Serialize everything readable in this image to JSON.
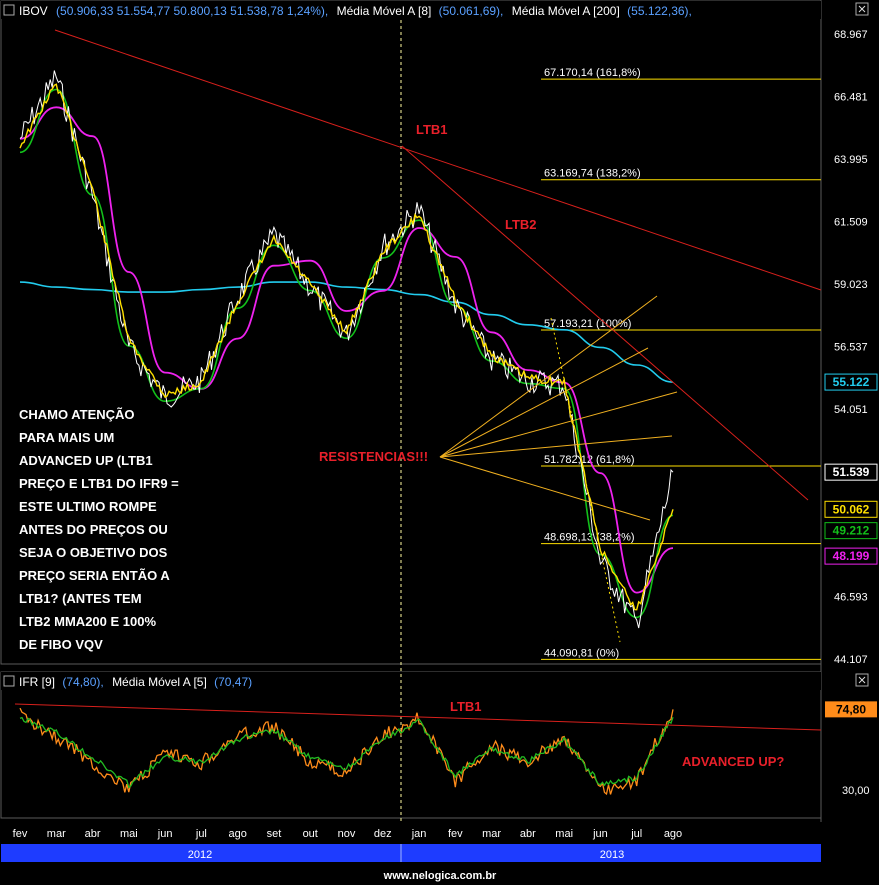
{
  "header_price": {
    "symbol": "IBOV",
    "ohlc": "(50.906,33  51.554,77  50.800,13  51.538,78  1,24%),",
    "ma1_label": "Média Móvel A [8]",
    "ma1_value": "(50.061,69),",
    "ma2_label": "Média Móvel A [200]",
    "ma2_value": "(55.122,36),"
  },
  "header_ifr": {
    "label": "IFR [9]",
    "value": "(74,80),",
    "ma_label": "Média Móvel A [5]",
    "ma_value": "(70,47)"
  },
  "colors": {
    "price": "#ffffff",
    "ma8": "#ffe100",
    "ma_green": "#12c01a",
    "ma_magenta": "#ee22ee",
    "ma200": "#22ccee",
    "trend": "#d8201c",
    "fibo": "#ffe100",
    "fan": "#f0b020",
    "ifr": "#ff8c1a",
    "ifr_ma": "#22bb22",
    "accent_blue": "#1e3cff"
  },
  "annotations": {
    "ltb1": "LTB1",
    "ltb2": "LTB2",
    "resistencias": "RESISTENCIAS!!!",
    "ltb1_ifr": "LTB1",
    "advanced_up": "ADVANCED UP?",
    "note_lines": [
      "CHAMO ATENÇÃO",
      "PARA MAIS UM",
      "ADVANCED UP (LTB1",
      "PREÇO E LTB1 DO IFR9 =",
      "ESTE ULTIMO ROMPE",
      "ANTES DO PREÇOS OU",
      "SEJA O OBJETIVO DOS",
      "PREÇO SERIA ENTÃO A",
      "LTB1? (ANTES TEM",
      "LTB2 MMA200 E 100%",
      "DE FIBO VQV"
    ]
  },
  "price_axis": {
    "ticks": [
      "68.967",
      "66.481",
      "63.995",
      "61.509",
      "59.023",
      "56.537",
      "54.051",
      "46.593",
      "44.107"
    ],
    "badges": [
      {
        "label": "55.122",
        "bg": "#000000",
        "fg": "#22ccee"
      },
      {
        "label": "51.539",
        "bg": "#000000",
        "fg": "#ffffff"
      },
      {
        "label": "50.062",
        "bg": "#000000",
        "fg": "#ffe100"
      },
      {
        "label": "49.212",
        "bg": "#000000",
        "fg": "#12c01a"
      },
      {
        "label": "48.199",
        "bg": "#000000",
        "fg": "#ee22ee"
      }
    ]
  },
  "ifr_axis": {
    "ticks": [
      "30,00"
    ],
    "badges": [
      {
        "label": "74,80",
        "bg": "#ff8c1a",
        "fg": "#000000"
      }
    ]
  },
  "fibo_levels": [
    {
      "label": "67.170,14 (161,8%)",
      "value": 67170.14
    },
    {
      "label": "63.169,74 (138,2%)",
      "value": 63169.74
    },
    {
      "label": "57.193,21 (100%)",
      "value": 57193.21
    },
    {
      "label": "51.782,12 (61,8%)",
      "value": 51782.12
    },
    {
      "label": "48.698,13 (38,2%)",
      "value": 48698.13
    },
    {
      "label": "44.090,81 (0%)",
      "value": 44090.81
    }
  ],
  "time_axis": {
    "months": [
      "fev",
      "mar",
      "abr",
      "mai",
      "jun",
      "jul",
      "ago",
      "set",
      "out",
      "nov",
      "dez",
      "jan",
      "fev",
      "mar",
      "abr",
      "mai",
      "jun",
      "jul",
      "ago"
    ],
    "years": [
      "2012",
      "2013"
    ]
  },
  "footer": "www.nelogica.com.br",
  "chart_data": [
    {
      "type": "line",
      "name": "IBOV",
      "ylim": [
        44107,
        68967
      ],
      "x": [
        "2012-02",
        "2012-03",
        "2012-04",
        "2012-05",
        "2012-06",
        "2012-07",
        "2012-08",
        "2012-09",
        "2012-10",
        "2012-11",
        "2012-12",
        "2013-01",
        "2013-02",
        "2013-03",
        "2013-04",
        "2013-05",
        "2013-06",
        "2013-07",
        "2013-08"
      ],
      "series": [
        {
          "name": "IBOV",
          "values": [
            64800,
            67300,
            62500,
            56500,
            54500,
            55200,
            58500,
            61000,
            58900,
            57000,
            60500,
            62000,
            58200,
            56000,
            55200,
            55000,
            48000,
            45500,
            51539
          ]
        },
        {
          "name": "Média Móvel A [8]",
          "values": [
            64500,
            67000,
            62800,
            56800,
            54600,
            55100,
            58300,
            60800,
            59000,
            57100,
            60300,
            61800,
            58400,
            56200,
            55300,
            55100,
            48500,
            46000,
            50062
          ]
        },
        {
          "name": "Média Móvel A [200]",
          "values": [
            59100,
            58900,
            58800,
            58700,
            58700,
            58800,
            58900,
            59100,
            59100,
            58900,
            58800,
            58600,
            58300,
            57800,
            57400,
            57200,
            56500,
            55800,
            55122
          ]
        }
      ]
    },
    {
      "type": "line",
      "name": "IFR",
      "x": [
        "2012-02",
        "2012-03",
        "2012-04",
        "2012-05",
        "2012-06",
        "2012-07",
        "2012-08",
        "2012-09",
        "2012-10",
        "2012-11",
        "2012-12",
        "2013-01",
        "2013-02",
        "2013-03",
        "2013-04",
        "2013-05",
        "2013-06",
        "2013-07",
        "2013-08"
      ],
      "yticks": [
        "30,00"
      ],
      "series": [
        {
          "name": "IFR [9]",
          "values": [
            72,
            60,
            45,
            30,
            50,
            45,
            60,
            65,
            45,
            40,
            60,
            70,
            35,
            55,
            45,
            60,
            30,
            35,
            74.8
          ]
        },
        {
          "name": "Média Móvel A [5]",
          "values": [
            70,
            62,
            48,
            33,
            48,
            46,
            58,
            63,
            48,
            42,
            58,
            68,
            38,
            53,
            46,
            58,
            33,
            37,
            70.47
          ]
        }
      ]
    }
  ]
}
